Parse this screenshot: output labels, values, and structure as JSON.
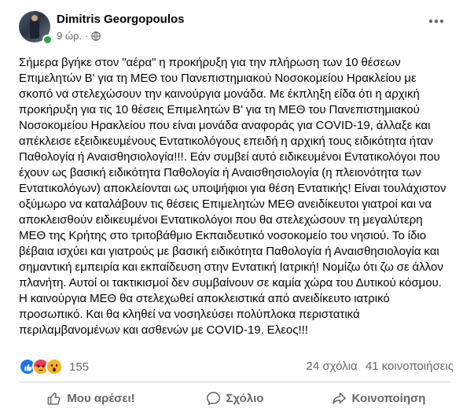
{
  "post": {
    "author": "Dimitris Georgopoulos",
    "time": "9 ώρ.",
    "separator": "·",
    "text": "Σήμερα βγήκε στον \"αέρα\" η προκήρυξη για την πλήρωση των 10 θέσεων Επιμελητών Β' για τη ΜΕΘ του Πανεπιστημιακού Νοσοκομείου Ηρακλείου με σκοπό να στελεχώσουν την καινούργια μονάδα.  Με έκπληξη είδα ότι η αρχική προκήρυξη για τις 10 θέσεις Επιμελητών Β' για τη ΜΕΘ του Πανεπιστημιακού Νοσοκομείου Ηρακλείου που είναι μονάδα αναφοράς για COVID-19, άλλαξε και απέκλεισε  εξειδικευμένους Εντατικολόγους επειδή η αρχική τους ειδικότητα ήταν Παθολογία ή Αναισθησιολογία!!!. Εάν συμβεί αυτό ειδικευμένοι Εντατικολόγοι που έχουν ως βασική ειδικότητα Παθολογία ή Αναισθησιολογία (η πλειονότητα των Εντατικολόγων) αποκλείονται ως υποψήφιοι για θέση Εντατικής! Είναι τουλάχιστον οξύμωρο να καταλάβουν τις θέσεις Επιμελητών ΜΕΘ ανειδίκευτοι γιατροί και να αποκλεισθούν ειδικευμένοι Εντατικολόγοι που θα στελεχώσουν τη μεγαλύτερη ΜΕΘ της Κρήτης στο τριτοβάθμιο Εκπαιδευτικό νοσοκομείο του νησιού.  Το ίδιο βέβαια ισχύει και γιατρούς με βασική ειδικότητα Παθολογία ή Αναισθησιολογία και σημαντική εμπειρία και εκπαίδευση στην Εντατική Ιατρική! Νομίζω ότι ζω σε άλλον πλανήτη.  Αυτοί οι τακτικισμοί δεν συμβαίνουν σε καμία χώρα του Δυτικού κόσμου.  Η καινούργια ΜΕΘ θα στελεχωθεί αποκλειστικά από ανειδίκευτο ιατρικό προσωπικό. Και θα κληθεί να νοσηλεύσει πολύπλοκα περιστατικά  περιλαμβανομένων και ασθενών με COVID-19.  Ελεος!!!",
    "reactions_count": "155",
    "comments": "24 σχόλια",
    "shares": "41 κοινοποιήσεις",
    "reaction_icons": [
      "like-icon",
      "angry-icon",
      "wow-icon"
    ]
  },
  "actions": {
    "like": "Μου αρέσει!",
    "comment": "Σχόλιο",
    "share": "Κοινοποίηση"
  },
  "colors": {
    "like_blue": "#1877f2",
    "angry_orange": "#e9710f",
    "wow_yellow": "#f7b125",
    "online_green": "#31a24c",
    "secondary_text": "#65676b"
  }
}
